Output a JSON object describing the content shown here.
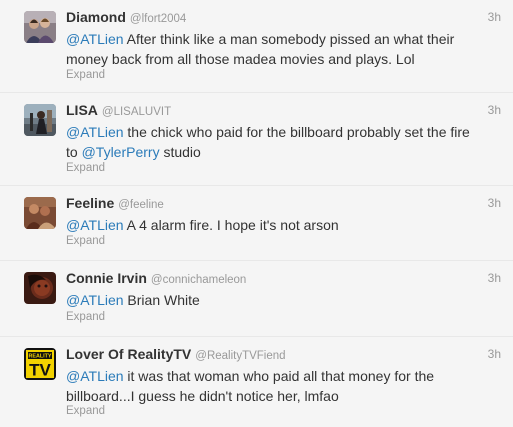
{
  "tweets": [
    {
      "name": "Diamond",
      "handle": "@lfort2004",
      "time": "3h",
      "mention": "@ATLien",
      "text": " After think like a man somebody pissed an what their money back from all those madea movies and plays. Lol",
      "expand": "Expand"
    },
    {
      "name": "LISA",
      "handle": "@LISALUVIT",
      "time": "3h",
      "mention": "@ATLien",
      "text": " the chick who paid for the billboard probably set the fire to ",
      "mention2": "@TylerPerry",
      "text2": " studio",
      "expand": "Expand"
    },
    {
      "name": "Feeline",
      "handle": "@feeline",
      "time": "3h",
      "mention": "@ATLien",
      "text": " A 4 alarm fire. I hope it's not arson",
      "expand": "Expand"
    },
    {
      "name": "Connie Irvin",
      "handle": "@connichameleon",
      "time": "3h",
      "mention": "@ATLien",
      "text": " Brian White",
      "expand": "Expand"
    },
    {
      "name": "Lover Of RealityTV",
      "handle": "@RealityTVFiend",
      "time": "3h",
      "mention": "@ATLien",
      "text": " it was that woman who paid all that money for the billboard...I guess he didn't notice her, lmfao",
      "expand": "Expand",
      "avatar_logo": [
        "REALITY",
        "TV"
      ]
    }
  ],
  "colors": {
    "link": "#2b7bb9",
    "background": "#f5f5f5",
    "muted": "#999999"
  }
}
